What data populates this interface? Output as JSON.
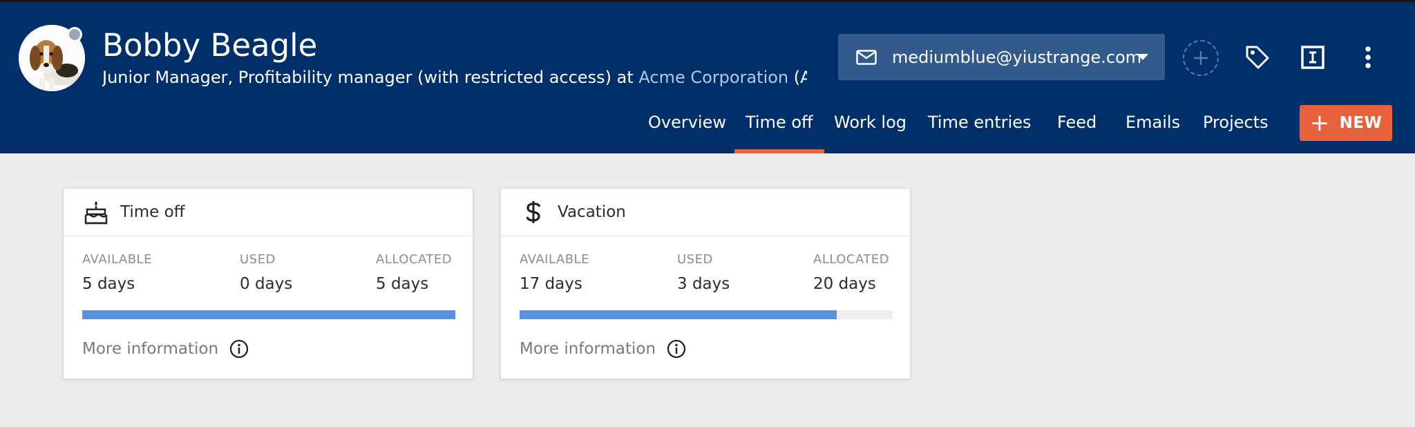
{
  "profile": {
    "name": "Bobby Beagle",
    "role_prefix": "Junior Manager, Profitability manager (with restricted access) at ",
    "company": "Acme Corporation",
    "role_suffix": " (Ac..."
  },
  "email_button": {
    "label": "mediumblue@yiustrange.com"
  },
  "nav": {
    "tabs": [
      {
        "label": "Overview"
      },
      {
        "label": "Time off"
      },
      {
        "label": "Work log"
      },
      {
        "label": "Time entries"
      },
      {
        "label": "Feed"
      },
      {
        "label": "Emails"
      },
      {
        "label": "Projects"
      }
    ],
    "active_tab": "Time off",
    "new_button": "NEW"
  },
  "cards": [
    {
      "title": "Time off",
      "icon": "cake-icon",
      "available_label": "AVAILABLE",
      "available": "5 days",
      "used_label": "USED",
      "used": "0 days",
      "allocated_label": "ALLOCATED",
      "allocated": "5 days",
      "progress": 1.0,
      "more": "More information"
    },
    {
      "title": "Vacation",
      "icon": "dollar-icon",
      "available_label": "AVAILABLE",
      "available": "17 days",
      "used_label": "USED",
      "used": "3 days",
      "allocated_label": "ALLOCATED",
      "allocated": "20 days",
      "progress": 0.85,
      "more": "More information"
    }
  ],
  "colors": {
    "header_bg": "#012f69",
    "accent": "#e8623e",
    "progress": "#5a91de",
    "email_btn": "#325a8a"
  }
}
